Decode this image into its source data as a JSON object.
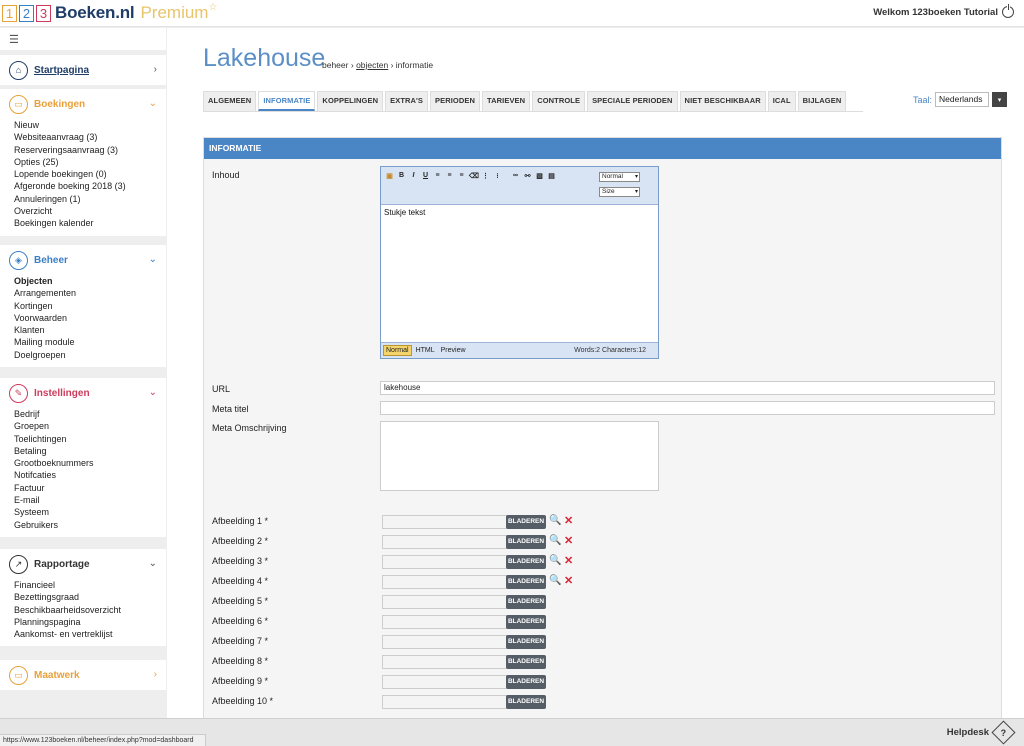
{
  "header": {
    "logo_digits": [
      "1",
      "2",
      "3"
    ],
    "brand": "Boeken.nl",
    "premium": "Premium",
    "star": "☆",
    "welcome": "Welkom 123boeken Tutorial"
  },
  "sidebar": {
    "toggle_icon": "☰",
    "sections": [
      {
        "title": "Startpagina",
        "color": "#1f3d66",
        "icon": "⌂",
        "chev": "›",
        "items": []
      },
      {
        "title": "Boekingen",
        "color": "#e8a13a",
        "icon": "▭",
        "chev": "⌄",
        "items": [
          "Nieuw",
          "Websiteaanvraag (3)",
          "Reserveringsaanvraag (3)",
          "Opties (25)",
          "Lopende boekingen (0)",
          "Afgeronde boeking 2018 (3)",
          "Annuleringen (1)",
          "Overzicht",
          "Boekingen kalender"
        ]
      },
      {
        "title": "Beheer",
        "color": "#3a7fc6",
        "icon": "◈",
        "chev": "⌄",
        "items": [
          "Objecten",
          "Arrangementen",
          "Kortingen",
          "Voorwaarden",
          "Klanten",
          "Mailing module",
          "Doelgroepen"
        ]
      },
      {
        "title": "Instellingen",
        "color": "#cc3b5d",
        "icon": "✎",
        "chev": "⌄",
        "items": [
          "Bedrijf",
          "Groepen",
          "Toelichtingen",
          "Betaling",
          "Grootboeknummers",
          "Notifcaties",
          "Factuur",
          "E-mail",
          "Systeem",
          "Gebruikers"
        ]
      },
      {
        "title": "Rapportage",
        "color": "#333333",
        "icon": "↗",
        "chev": "⌄",
        "items": [
          "Financieel",
          "Bezettingsgraad",
          "Beschikbaarheidsoverzicht",
          "Planningspagina",
          "Aankomst- en vertreklijst"
        ]
      },
      {
        "title": "Maatwerk",
        "color": "#e8a13a",
        "icon": "▭",
        "chev": "›",
        "items": []
      }
    ]
  },
  "main": {
    "title": "Lakehouse",
    "breadcrumb": {
      "part1": "beheer",
      "sep": "›",
      "link": "objecten",
      "current": "informatie"
    },
    "tabs": [
      "ALGEMEEN",
      "INFORMATIE",
      "KOPPELINGEN",
      "EXTRA'S",
      "PERIODEN",
      "TARIEVEN",
      "CONTROLE",
      "SPECIALE PERIODEN",
      "NIET BESCHIKBAAR",
      "ICAL",
      "BIJLAGEN"
    ],
    "active_tab": "INFORMATIE",
    "language": {
      "label": "Taal:",
      "value": "Nederlands",
      "arrow": "▾"
    }
  },
  "panel": {
    "title": "INFORMATIE",
    "labels": {
      "inhoud": "Inhoud",
      "url": "URL",
      "meta_titel": "Meta titel",
      "meta_omschrijving": "Meta Omschrijving"
    },
    "editor": {
      "tool_bold": "B",
      "tool_italic": "I",
      "tool_underline": "U",
      "format": "Normal",
      "size": "Size",
      "content": "Stukje tekst",
      "mode_normal": "Normal",
      "mode_html": "HTML",
      "mode_preview": "Preview",
      "stats": "Words:2 Characters:12"
    },
    "url_value": "lakehouse",
    "meta_titel_value": "",
    "browse_label": "BLADEREN",
    "images": [
      "Afbeelding 1 *",
      "Afbeelding 2 *",
      "Afbeelding 3 *",
      "Afbeelding 4 *",
      "Afbeelding 5 *",
      "Afbeelding 6 *",
      "Afbeelding 7 *",
      "Afbeelding 8 *",
      "Afbeelding 9 *",
      "Afbeelding 10 *"
    ],
    "images_with_actions": 4
  },
  "footer": {
    "helpdesk": "Helpdesk",
    "status_url": "https://www.123boeken.nl/beheer/index.php?mod=dashboard"
  }
}
